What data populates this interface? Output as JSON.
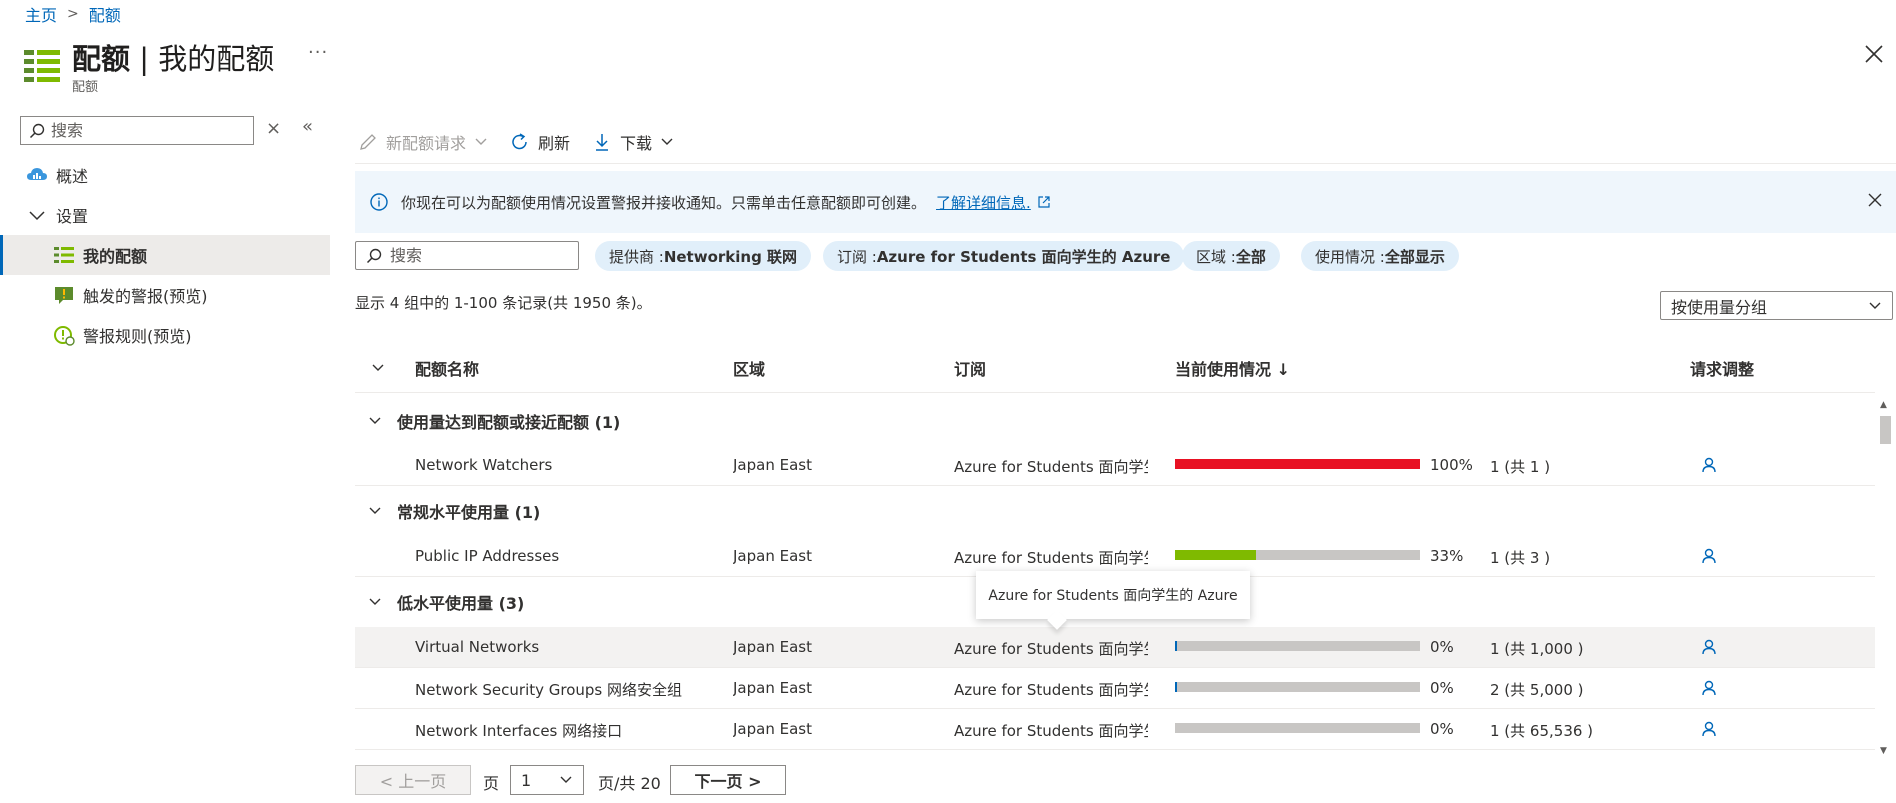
{
  "breadcrumb": {
    "home": "主页",
    "current": "配额"
  },
  "header": {
    "title_bold": "配额",
    "title_rest": " | 我的配额",
    "subtitle": "配额",
    "more": "···"
  },
  "nav": {
    "search_placeholder": "搜索",
    "items": [
      {
        "label": "概述",
        "icon": "cloud-icon"
      },
      {
        "label": "设置",
        "icon": "chevron-down-icon"
      },
      {
        "label": "我的配额",
        "icon": "list-icon"
      },
      {
        "label": "触发的警报(预览)",
        "icon": "alert-icon"
      },
      {
        "label": "警报规则(预览)",
        "icon": "alert-rule-icon"
      }
    ]
  },
  "toolbar": {
    "new_request": "新配额请求",
    "refresh": "刷新",
    "download": "下载"
  },
  "banner": {
    "text": "你现在可以为配额使用情况设置警报并接收通知。只需单击任意配额即可创建。",
    "link": "了解详细信息."
  },
  "filters": {
    "search_placeholder": "搜索",
    "provider_label": "提供商 : ",
    "provider_value": "Networking 联网",
    "subscription_label": "订阅 : ",
    "subscription_value": "Azure for Students 面向学生的 Azure",
    "region_label": "区域 : ",
    "region_value": "全部",
    "usage_label": "使用情况 : ",
    "usage_value": "全部显示"
  },
  "records_text": "显示 4 组中的 1-100 条记录(共 1950 条)。",
  "group_by": "按使用量分组",
  "columns": {
    "name": "配额名称",
    "region": "区域",
    "subscription": "订阅",
    "usage": "当前使用情况 ↓",
    "request": "请求调整"
  },
  "groups": [
    {
      "label": "使用量达到配额或接近配额 (1)"
    },
    {
      "label": "常规水平使用量 (1)"
    },
    {
      "label": "低水平使用量 (3)"
    }
  ],
  "rows": [
    {
      "name": "Network Watchers",
      "region": "Japan East",
      "subscription": "Azure for Students 面向学生的 Azure",
      "usage_fraction": 1.0,
      "pct": "100%",
      "count": "1 (共 1 )",
      "color": "#e81123"
    },
    {
      "name": "Public IP Addresses",
      "region": "Japan East",
      "subscription": "Azure for Students 面向学生的 Azure",
      "usage_fraction": 0.33,
      "pct": "33%",
      "count": "1 (共 3 )",
      "color": "#7fba00"
    },
    {
      "name": "Virtual Networks",
      "region": "Japan East",
      "subscription": "Azure for Students 面向学生的 Azure",
      "usage_fraction": 0.001,
      "pct": "0%",
      "count": "1 (共 1,000 )",
      "color": "#0067b8"
    },
    {
      "name": "Network Security Groups 网络安全组",
      "region": "Japan East",
      "subscription": "Azure for Students 面向学生的 Azure",
      "usage_fraction": 0.0004,
      "pct": "0%",
      "count": "2 (共 5,000 )",
      "color": "#0067b8"
    },
    {
      "name": "Network Interfaces 网络接口",
      "region": "Japan East",
      "subscription": "Azure for Students 面向学生的 Azure",
      "usage_fraction": 0.0,
      "pct": "0%",
      "count": "1 (共 65,536 )",
      "color": "#0067b8"
    }
  ],
  "tooltip": "Azure for Students 面向学生的 Azure",
  "pager": {
    "prev": "< 上一页",
    "page_label": "页",
    "page_value": "1",
    "total": "页/共 20",
    "next": "下一页 >"
  }
}
